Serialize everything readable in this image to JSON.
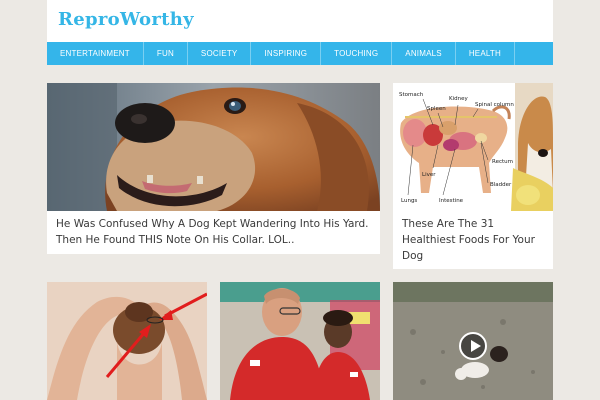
{
  "site": {
    "logo": "ReproWorthy"
  },
  "nav": {
    "items": [
      "ENTERTAINMENT",
      "FUN",
      "SOCIETY",
      "INSPIRING",
      "TOUCHING",
      "ANIMALS",
      "HEALTH"
    ]
  },
  "articles": [
    {
      "title": "He Was Confused Why A Dog Kept Wandering Into His Yard. Then He Found THIS Note On His Collar. LOL.."
    },
    {
      "title": "These Are The 31 Healthiest Foods For Your Dog"
    }
  ],
  "diagram": {
    "labels": [
      "Stomach",
      "Spleen",
      "Kidney",
      "Spinal column",
      "Liver",
      "Rectum",
      "Bladder",
      "Lungs",
      "Intestine"
    ]
  },
  "colors": {
    "accent": "#34b5ea",
    "logo": "#35b6e6",
    "background": "#ece9e4"
  }
}
